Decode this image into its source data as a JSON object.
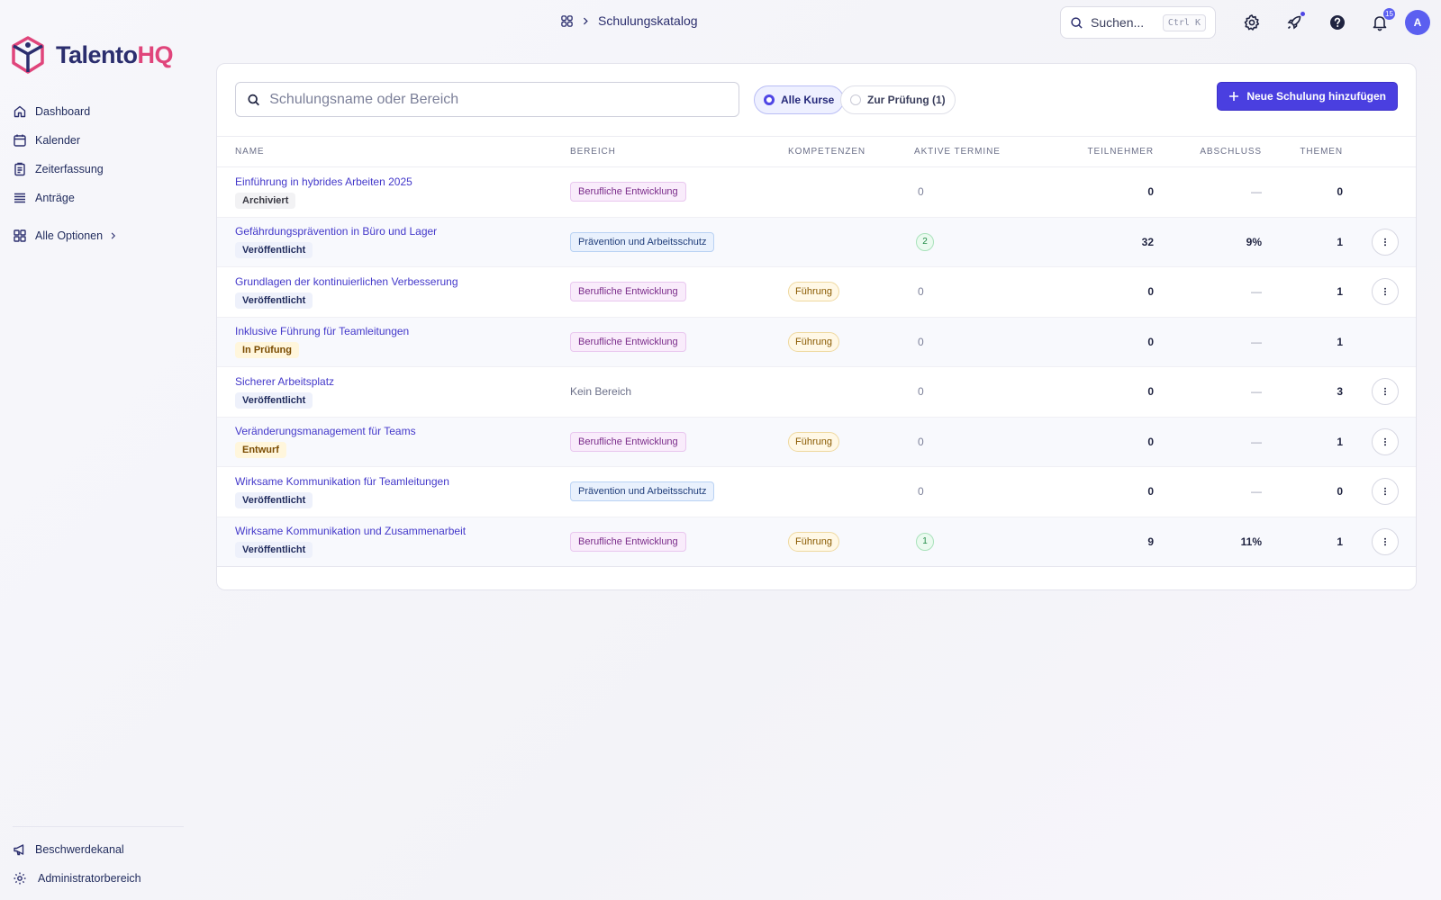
{
  "app": {
    "logo_part1": "Talento",
    "logo_part2": "HQ"
  },
  "breadcrumb": {
    "current": "Schulungskatalog"
  },
  "global_search": {
    "placeholder": "Suchen...",
    "shortcut": "Ctrl K"
  },
  "notifications": {
    "count": "15"
  },
  "user": {
    "initial": "A"
  },
  "sidebar": {
    "items": [
      {
        "label": "Dashboard",
        "icon": "home-icon"
      },
      {
        "label": "Kalender",
        "icon": "calendar-icon"
      },
      {
        "label": "Zeiterfassung",
        "icon": "clipboard-icon"
      },
      {
        "label": "Anträge",
        "icon": "stack-icon"
      }
    ],
    "all_options": "Alle Optionen",
    "bottom": [
      {
        "label": "Beschwerdekanal",
        "icon": "megaphone-icon"
      },
      {
        "label": "Administratorbereich",
        "icon": "gear-icon"
      }
    ]
  },
  "toolbar": {
    "search_placeholder": "Schulungsname oder Bereich",
    "filter_all": "Alle Kurse",
    "filter_review": "Zur Prüfung (1)",
    "add_button": "Neue Schulung hinzufügen"
  },
  "table": {
    "columns": [
      "NAME",
      "BEREICH",
      "KOMPETENZEN",
      "AKTIVE TERMINE",
      "TEILNEHMER",
      "ABSCHLUSS",
      "THEMEN"
    ],
    "rows": [
      {
        "name": "Einführung in hybrides Arbeiten 2025",
        "status": "Archiviert",
        "status_type": "arch",
        "area": "Berufliche Entwicklung",
        "area_type": "purple",
        "competence": "",
        "terms": "0",
        "participants": "0",
        "completion": "—",
        "topics": "0",
        "has_menu": false
      },
      {
        "name": "Gefährdungsprävention in Büro und Lager",
        "status": "Veröffentlicht",
        "status_type": "pub",
        "area": "Prävention und Arbeitsschutz",
        "area_type": "blue",
        "competence": "",
        "terms": "2",
        "participants": "32",
        "completion": "9%",
        "topics": "1",
        "has_menu": true
      },
      {
        "name": "Grundlagen der kontinuierlichen Verbesserung",
        "status": "Veröffentlicht",
        "status_type": "pub",
        "area": "Berufliche Entwicklung",
        "area_type": "purple",
        "competence": "Führung",
        "terms": "0",
        "participants": "0",
        "completion": "—",
        "topics": "1",
        "has_menu": true
      },
      {
        "name": "Inklusive Führung für Teamleitungen",
        "status": "In Prüfung",
        "status_type": "rev",
        "area": "Berufliche Entwicklung",
        "area_type": "purple",
        "competence": "Führung",
        "terms": "0",
        "participants": "0",
        "completion": "—",
        "topics": "1",
        "has_menu": false
      },
      {
        "name": "Sicherer Arbeitsplatz",
        "status": "Veröffentlicht",
        "status_type": "pub",
        "area": "Kein Bereich",
        "area_type": "none",
        "competence": "",
        "terms": "0",
        "participants": "0",
        "completion": "—",
        "topics": "3",
        "has_menu": true
      },
      {
        "name": "Veränderungsmanagement für Teams",
        "status": "Entwurf",
        "status_type": "draft",
        "area": "Berufliche Entwicklung",
        "area_type": "purple",
        "competence": "Führung",
        "terms": "0",
        "participants": "0",
        "completion": "—",
        "topics": "1",
        "has_menu": true
      },
      {
        "name": "Wirksame Kommunikation für Teamleitungen",
        "status": "Veröffentlicht",
        "status_type": "pub",
        "area": "Prävention und Arbeitsschutz",
        "area_type": "blue",
        "competence": "",
        "terms": "0",
        "participants": "0",
        "completion": "—",
        "topics": "0",
        "has_menu": true
      },
      {
        "name": "Wirksame Kommunikation und Zusammenarbeit",
        "status": "Veröffentlicht",
        "status_type": "pub",
        "area": "Berufliche Entwicklung",
        "area_type": "purple",
        "competence": "Führung",
        "terms": "1",
        "participants": "9",
        "completion": "11%",
        "topics": "1",
        "has_menu": true
      }
    ]
  }
}
